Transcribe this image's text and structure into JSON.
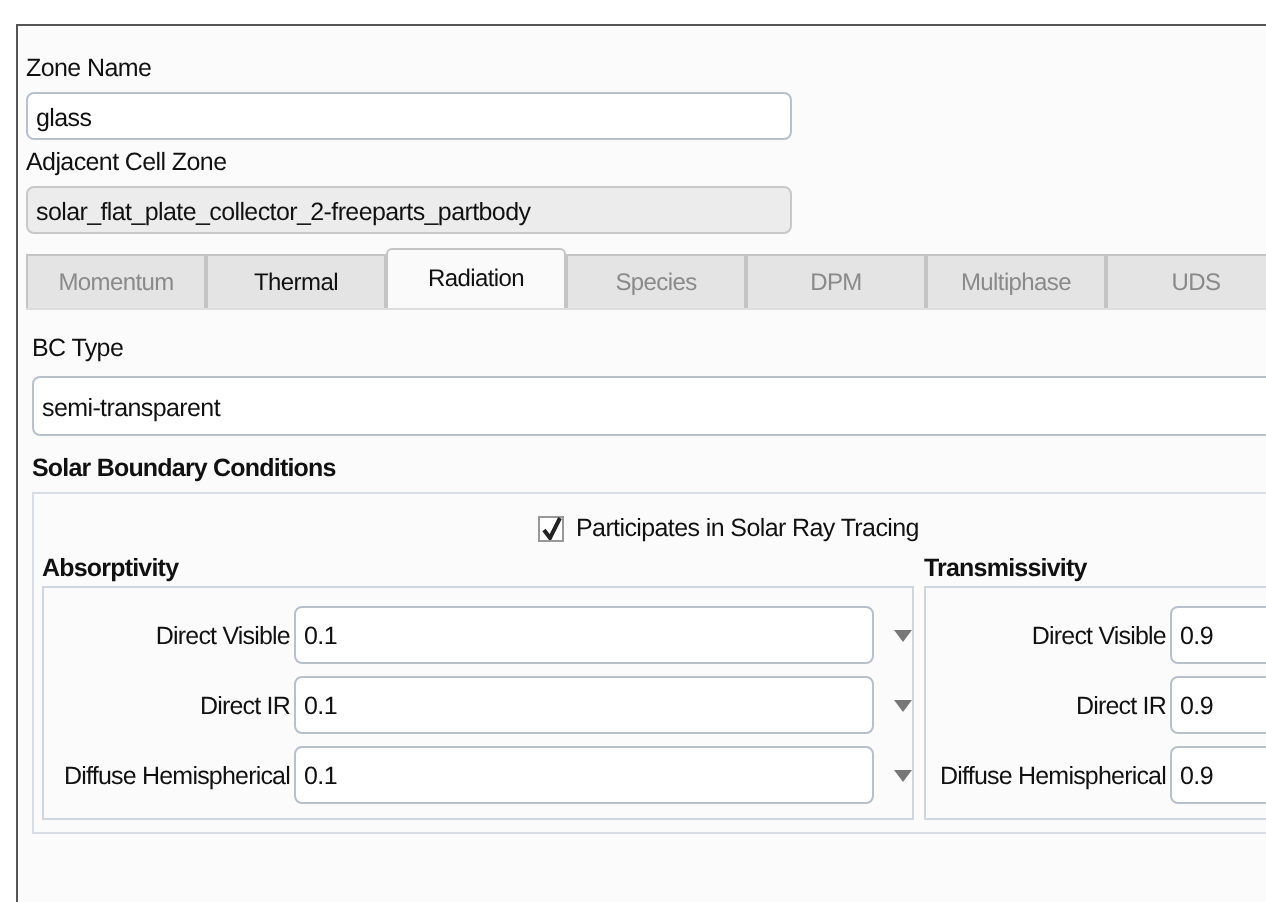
{
  "zone_name": {
    "label": "Zone Name",
    "value": "glass"
  },
  "adjacent_cell_zone": {
    "label": "Adjacent Cell Zone",
    "value": "solar_flat_plate_collector_2-freeparts_partbody"
  },
  "tabs": [
    {
      "label": "Momentum",
      "selected": false,
      "disabled": true
    },
    {
      "label": "Thermal",
      "selected": false,
      "disabled": false
    },
    {
      "label": "Radiation",
      "selected": true,
      "disabled": false
    },
    {
      "label": "Species",
      "selected": false,
      "disabled": true
    },
    {
      "label": "DPM",
      "selected": false,
      "disabled": true
    },
    {
      "label": "Multiphase",
      "selected": false,
      "disabled": true
    },
    {
      "label": "UDS",
      "selected": false,
      "disabled": true
    }
  ],
  "bc_type": {
    "label": "BC Type",
    "value": "semi-transparent"
  },
  "solar": {
    "title": "Solar Boundary Conditions",
    "participates": {
      "label": "Participates in Solar Ray Tracing",
      "checked": true
    },
    "groups": [
      {
        "title": "Absorptivity",
        "rows": [
          {
            "label": "Direct Visible",
            "value": "0.1"
          },
          {
            "label": "Direct IR",
            "value": "0.1"
          },
          {
            "label": "Diffuse Hemispherical",
            "value": "0.1"
          }
        ]
      },
      {
        "title": "Transmissivity",
        "rows": [
          {
            "label": "Direct Visible",
            "value": "0.9"
          },
          {
            "label": "Direct IR",
            "value": "0.9"
          },
          {
            "label": "Diffuse Hemispherical",
            "value": "0.9"
          }
        ]
      }
    ]
  }
}
